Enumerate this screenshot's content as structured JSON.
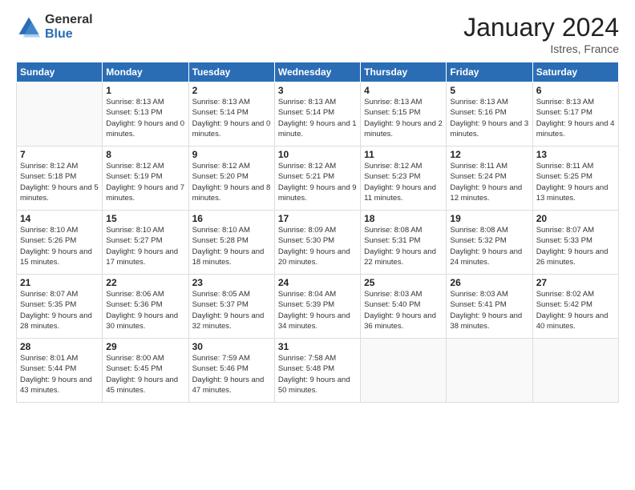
{
  "logo": {
    "general": "General",
    "blue": "Blue"
  },
  "title": "January 2024",
  "subtitle": "Istres, France",
  "days_header": [
    "Sunday",
    "Monday",
    "Tuesday",
    "Wednesday",
    "Thursday",
    "Friday",
    "Saturday"
  ],
  "weeks": [
    [
      {
        "num": "",
        "sunrise": "",
        "sunset": "",
        "daylight": ""
      },
      {
        "num": "1",
        "sunrise": "Sunrise: 8:13 AM",
        "sunset": "Sunset: 5:13 PM",
        "daylight": "Daylight: 9 hours and 0 minutes."
      },
      {
        "num": "2",
        "sunrise": "Sunrise: 8:13 AM",
        "sunset": "Sunset: 5:14 PM",
        "daylight": "Daylight: 9 hours and 0 minutes."
      },
      {
        "num": "3",
        "sunrise": "Sunrise: 8:13 AM",
        "sunset": "Sunset: 5:14 PM",
        "daylight": "Daylight: 9 hours and 1 minute."
      },
      {
        "num": "4",
        "sunrise": "Sunrise: 8:13 AM",
        "sunset": "Sunset: 5:15 PM",
        "daylight": "Daylight: 9 hours and 2 minutes."
      },
      {
        "num": "5",
        "sunrise": "Sunrise: 8:13 AM",
        "sunset": "Sunset: 5:16 PM",
        "daylight": "Daylight: 9 hours and 3 minutes."
      },
      {
        "num": "6",
        "sunrise": "Sunrise: 8:13 AM",
        "sunset": "Sunset: 5:17 PM",
        "daylight": "Daylight: 9 hours and 4 minutes."
      }
    ],
    [
      {
        "num": "7",
        "sunrise": "Sunrise: 8:12 AM",
        "sunset": "Sunset: 5:18 PM",
        "daylight": "Daylight: 9 hours and 5 minutes."
      },
      {
        "num": "8",
        "sunrise": "Sunrise: 8:12 AM",
        "sunset": "Sunset: 5:19 PM",
        "daylight": "Daylight: 9 hours and 7 minutes."
      },
      {
        "num": "9",
        "sunrise": "Sunrise: 8:12 AM",
        "sunset": "Sunset: 5:20 PM",
        "daylight": "Daylight: 9 hours and 8 minutes."
      },
      {
        "num": "10",
        "sunrise": "Sunrise: 8:12 AM",
        "sunset": "Sunset: 5:21 PM",
        "daylight": "Daylight: 9 hours and 9 minutes."
      },
      {
        "num": "11",
        "sunrise": "Sunrise: 8:12 AM",
        "sunset": "Sunset: 5:23 PM",
        "daylight": "Daylight: 9 hours and 11 minutes."
      },
      {
        "num": "12",
        "sunrise": "Sunrise: 8:11 AM",
        "sunset": "Sunset: 5:24 PM",
        "daylight": "Daylight: 9 hours and 12 minutes."
      },
      {
        "num": "13",
        "sunrise": "Sunrise: 8:11 AM",
        "sunset": "Sunset: 5:25 PM",
        "daylight": "Daylight: 9 hours and 13 minutes."
      }
    ],
    [
      {
        "num": "14",
        "sunrise": "Sunrise: 8:10 AM",
        "sunset": "Sunset: 5:26 PM",
        "daylight": "Daylight: 9 hours and 15 minutes."
      },
      {
        "num": "15",
        "sunrise": "Sunrise: 8:10 AM",
        "sunset": "Sunset: 5:27 PM",
        "daylight": "Daylight: 9 hours and 17 minutes."
      },
      {
        "num": "16",
        "sunrise": "Sunrise: 8:10 AM",
        "sunset": "Sunset: 5:28 PM",
        "daylight": "Daylight: 9 hours and 18 minutes."
      },
      {
        "num": "17",
        "sunrise": "Sunrise: 8:09 AM",
        "sunset": "Sunset: 5:30 PM",
        "daylight": "Daylight: 9 hours and 20 minutes."
      },
      {
        "num": "18",
        "sunrise": "Sunrise: 8:08 AM",
        "sunset": "Sunset: 5:31 PM",
        "daylight": "Daylight: 9 hours and 22 minutes."
      },
      {
        "num": "19",
        "sunrise": "Sunrise: 8:08 AM",
        "sunset": "Sunset: 5:32 PM",
        "daylight": "Daylight: 9 hours and 24 minutes."
      },
      {
        "num": "20",
        "sunrise": "Sunrise: 8:07 AM",
        "sunset": "Sunset: 5:33 PM",
        "daylight": "Daylight: 9 hours and 26 minutes."
      }
    ],
    [
      {
        "num": "21",
        "sunrise": "Sunrise: 8:07 AM",
        "sunset": "Sunset: 5:35 PM",
        "daylight": "Daylight: 9 hours and 28 minutes."
      },
      {
        "num": "22",
        "sunrise": "Sunrise: 8:06 AM",
        "sunset": "Sunset: 5:36 PM",
        "daylight": "Daylight: 9 hours and 30 minutes."
      },
      {
        "num": "23",
        "sunrise": "Sunrise: 8:05 AM",
        "sunset": "Sunset: 5:37 PM",
        "daylight": "Daylight: 9 hours and 32 minutes."
      },
      {
        "num": "24",
        "sunrise": "Sunrise: 8:04 AM",
        "sunset": "Sunset: 5:39 PM",
        "daylight": "Daylight: 9 hours and 34 minutes."
      },
      {
        "num": "25",
        "sunrise": "Sunrise: 8:03 AM",
        "sunset": "Sunset: 5:40 PM",
        "daylight": "Daylight: 9 hours and 36 minutes."
      },
      {
        "num": "26",
        "sunrise": "Sunrise: 8:03 AM",
        "sunset": "Sunset: 5:41 PM",
        "daylight": "Daylight: 9 hours and 38 minutes."
      },
      {
        "num": "27",
        "sunrise": "Sunrise: 8:02 AM",
        "sunset": "Sunset: 5:42 PM",
        "daylight": "Daylight: 9 hours and 40 minutes."
      }
    ],
    [
      {
        "num": "28",
        "sunrise": "Sunrise: 8:01 AM",
        "sunset": "Sunset: 5:44 PM",
        "daylight": "Daylight: 9 hours and 43 minutes."
      },
      {
        "num": "29",
        "sunrise": "Sunrise: 8:00 AM",
        "sunset": "Sunset: 5:45 PM",
        "daylight": "Daylight: 9 hours and 45 minutes."
      },
      {
        "num": "30",
        "sunrise": "Sunrise: 7:59 AM",
        "sunset": "Sunset: 5:46 PM",
        "daylight": "Daylight: 9 hours and 47 minutes."
      },
      {
        "num": "31",
        "sunrise": "Sunrise: 7:58 AM",
        "sunset": "Sunset: 5:48 PM",
        "daylight": "Daylight: 9 hours and 50 minutes."
      },
      {
        "num": "",
        "sunrise": "",
        "sunset": "",
        "daylight": ""
      },
      {
        "num": "",
        "sunrise": "",
        "sunset": "",
        "daylight": ""
      },
      {
        "num": "",
        "sunrise": "",
        "sunset": "",
        "daylight": ""
      }
    ]
  ]
}
